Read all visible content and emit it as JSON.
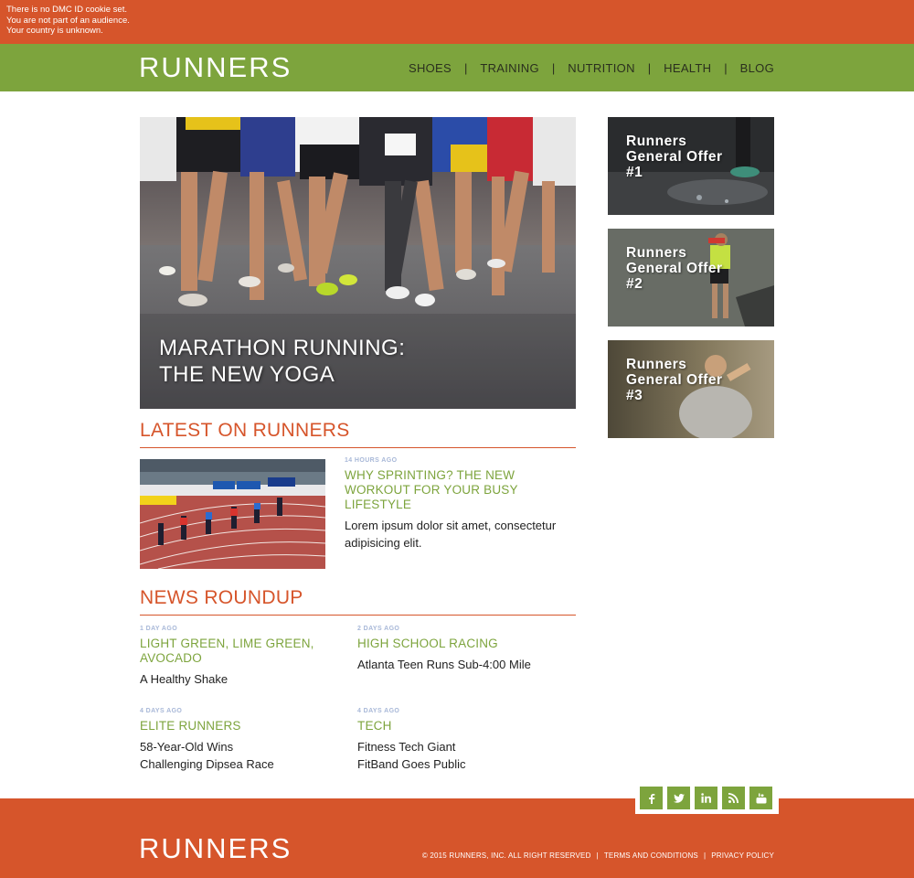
{
  "cookie_notice": [
    "There is no DMC ID cookie set.",
    "You are not part of an audience.",
    "Your country is unknown."
  ],
  "brand": {
    "name": "RUNNERS",
    "orange": "#d6552b",
    "green": "#7da43d"
  },
  "nav": [
    "SHOES",
    "TRAINING",
    "NUTRITION",
    "HEALTH",
    "BLOG"
  ],
  "hero": {
    "title_line1": "MARATHON RUNNING:",
    "title_line2": "THE NEW YOGA"
  },
  "latest": {
    "section_title": "LATEST ON RUNNERS",
    "timestamp": "14 HOURS AGO",
    "headline": "WHY SPRINTING? THE NEW WORKOUT FOR YOUR BUSY LIFESTYLE",
    "description": "Lorem ipsum dolor sit amet, consectetur adipisicing elit."
  },
  "news": {
    "section_title": "NEWS ROUNDUP",
    "items": [
      {
        "timestamp": "1 DAY AGO",
        "headline": "LIGHT GREEN, LIME GREEN, AVOCADO",
        "description": "A Healthy Shake"
      },
      {
        "timestamp": "2 DAYS AGO",
        "headline": "HIGH SCHOOL RACING",
        "description": "Atlanta Teen Runs Sub-4:00 Mile"
      },
      {
        "timestamp": "4 DAYS AGO",
        "headline": "ELITE RUNNERS",
        "description": "58-Year-Old Wins Challenging Dipsea Race"
      },
      {
        "timestamp": "4 DAYS AGO",
        "headline": "TECH",
        "description": "Fitness Tech Giant FitBand Goes Public"
      }
    ]
  },
  "offers": [
    {
      "line1": "Runners",
      "line2": "General Offer",
      "line3": "#1"
    },
    {
      "line1": "Runners",
      "line2": "General Offer",
      "line3": "#2"
    },
    {
      "line1": "Runners",
      "line2": "General Offer",
      "line3": "#3"
    }
  ],
  "social": [
    "facebook-icon",
    "twitter-icon",
    "linkedin-icon",
    "rss-icon",
    "youtube-icon"
  ],
  "footer": {
    "copyright": "© 2015 RUNNERS, INC. ALL RIGHT RESERVED",
    "terms": "TERMS AND CONDITIONS",
    "privacy": "PRIVACY POLICY"
  }
}
